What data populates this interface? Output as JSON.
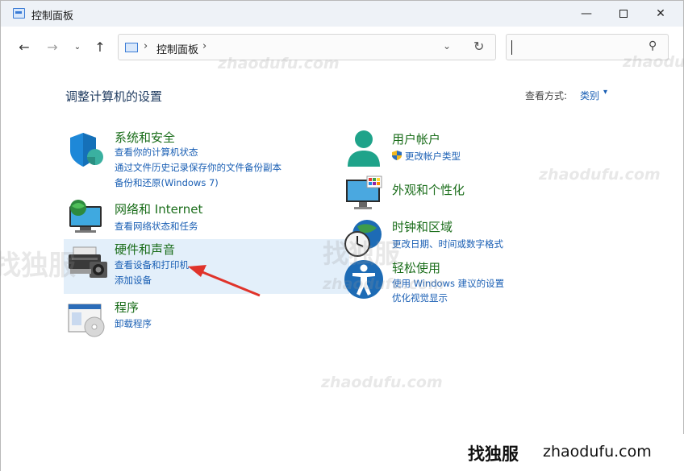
{
  "window": {
    "title": "控制面板",
    "controls": {
      "minimize": "—",
      "close": "✕"
    }
  },
  "nav": {
    "back": "←",
    "forward": "→",
    "recent": "⌄",
    "up": "↑"
  },
  "address": {
    "separator": "›",
    "path": "控制面板",
    "dropdown": "⌄",
    "refresh": "↻"
  },
  "search": {
    "placeholder": "",
    "icon": "⚲"
  },
  "main": {
    "heading": "调整计算机的设置",
    "view_by_label": "查看方式:",
    "view_by_value": "类别",
    "view_by_caret": "▾"
  },
  "categories": [
    {
      "title": "系统和安全",
      "links": [
        "查看你的计算机状态",
        "通过文件历史记录保存你的文件备份副本",
        "备份和还原(Windows 7)"
      ],
      "icon": "shield-icon"
    },
    {
      "title": "网络和 Internet",
      "links": [
        "查看网络状态和任务"
      ],
      "icon": "network-icon"
    },
    {
      "title": "硬件和声音",
      "links": [
        "查看设备和打印机",
        "添加设备"
      ],
      "icon": "printer-icon"
    },
    {
      "title": "程序",
      "links": [
        "卸载程序"
      ],
      "icon": "programs-icon"
    },
    {
      "title": "用户帐户",
      "links": [
        "更改帐户类型"
      ],
      "icon": "user-icon"
    },
    {
      "title": "外观和个性化",
      "links": [],
      "icon": "display-icon"
    },
    {
      "title": "时钟和区域",
      "links": [
        "更改日期、时间或数字格式"
      ],
      "icon": "clock-icon"
    },
    {
      "title": "轻松使用",
      "links": [
        "使用 Windows 建议的设置",
        "优化视觉显示"
      ],
      "icon": "accessibility-icon"
    }
  ],
  "watermarks": {
    "en": "zhaodufu.com",
    "cn": "找独服"
  },
  "brand": {
    "cn": "找独服",
    "en": "zhaodufu.com"
  },
  "colors": {
    "category_title": "#1a6d1a",
    "link": "#1a5fb4",
    "highlight": "#e3effa",
    "arrow": "#e0332a"
  }
}
